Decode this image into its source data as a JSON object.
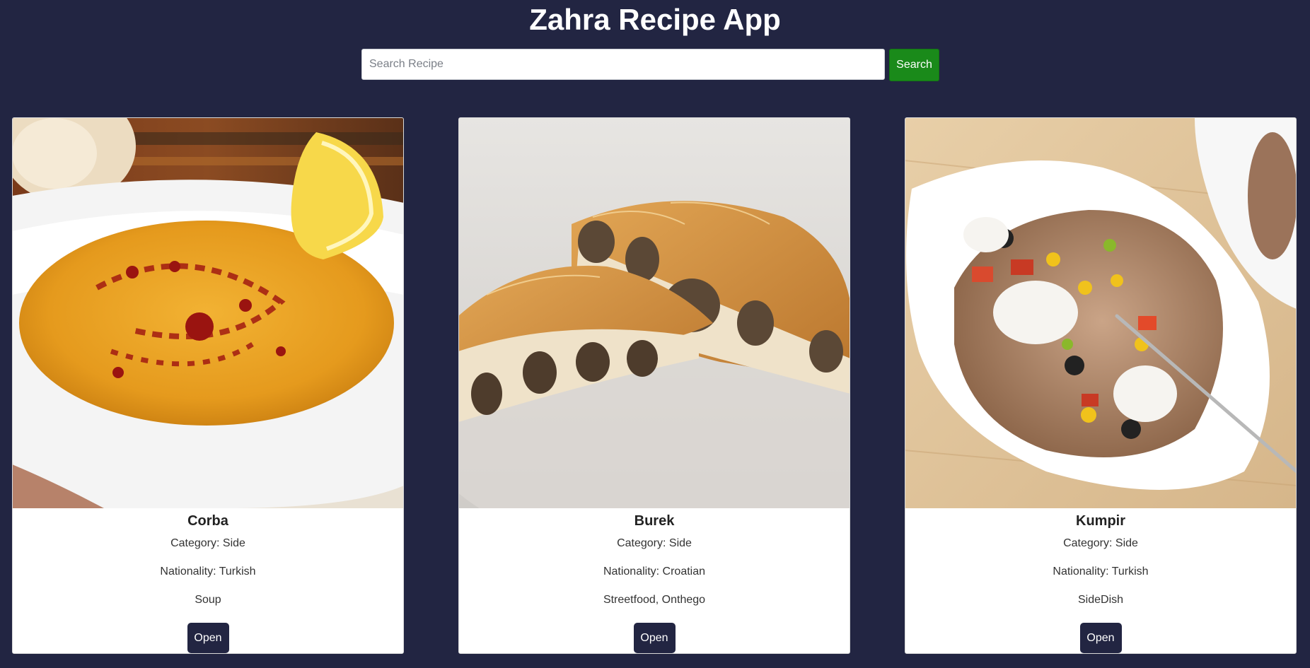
{
  "app": {
    "title": "Zahra Recipe App"
  },
  "search": {
    "placeholder": "Search Recipe",
    "value": "",
    "button_label": "Search"
  },
  "colors": {
    "background": "#222542",
    "search_button": "#1a8a1a",
    "open_button": "#222542"
  },
  "recipes": [
    {
      "name": "Corba",
      "category": "Category: Side",
      "nationality": "Nationality: Turkish",
      "tags": "Soup",
      "open_label": "Open",
      "image": "lentil-soup-bowl-with-lemon-image"
    },
    {
      "name": "Burek",
      "category": "Category: Side",
      "nationality": "Nationality: Croatian",
      "tags": "Streetfood, Onthego",
      "open_label": "Open",
      "image": "meat-pastry-slices-image"
    },
    {
      "name": "Kumpir",
      "category": "Category: Side",
      "nationality": "Nationality: Turkish",
      "tags": "SideDish",
      "open_label": "Open",
      "image": "loaded-baked-potato-image"
    }
  ]
}
